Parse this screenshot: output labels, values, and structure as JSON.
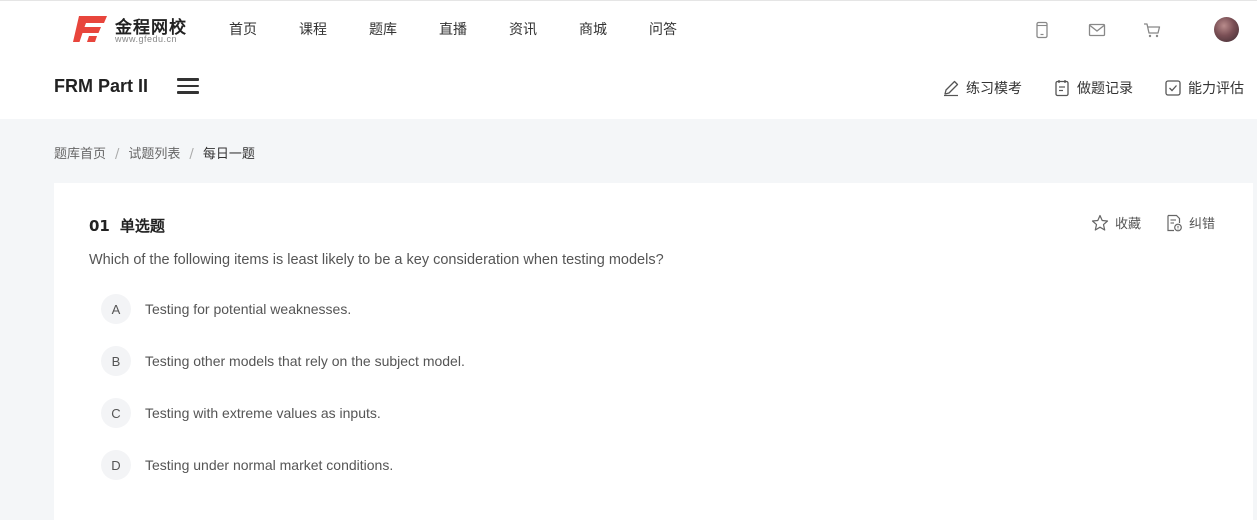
{
  "topbar": {
    "logo": {
      "name": "金程网校",
      "domain": "www.gfedu.cn"
    },
    "nav": [
      "首页",
      "课程",
      "题库",
      "直播",
      "资讯",
      "商城",
      "问答"
    ]
  },
  "subbar": {
    "course_title": "FRM Part II",
    "tools": [
      "练习模考",
      "做题记录",
      "能力评估"
    ]
  },
  "breadcrumb": {
    "items": [
      "题库首页",
      "试题列表"
    ],
    "current": "每日一题",
    "separator": "/"
  },
  "question": {
    "number": "01",
    "type": "单选题",
    "favorite_label": "收藏",
    "report_label": "纠错",
    "stem": "Which of the following items is least likely to be a key consideration when testing models?",
    "options": [
      {
        "letter": "A",
        "text": "Testing for potential weaknesses."
      },
      {
        "letter": "B",
        "text": "Testing other models that rely on the subject model."
      },
      {
        "letter": "C",
        "text": "Testing with extreme values as inputs."
      },
      {
        "letter": "D",
        "text": "Testing under normal market conditions."
      }
    ]
  },
  "colors": {
    "brand_red": "#e8453c",
    "page_bg": "#f4f6f8"
  },
  "icons": [
    "logo-icon",
    "phone-icon",
    "mail-icon",
    "cart-icon",
    "menu-icon",
    "pencil-icon",
    "clipboard-icon",
    "checkbox-icon",
    "star-icon",
    "report-icon"
  ]
}
